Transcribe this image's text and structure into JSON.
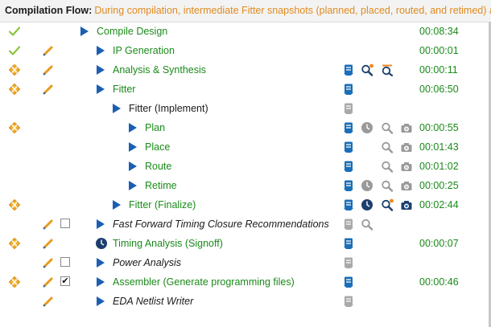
{
  "header": {
    "label": "Compilation Flow:",
    "description": "During compilation, intermediate Fitter snapshots (planned, placed, routed, and retimed) are created"
  },
  "colors": {
    "done_text": "#1a8a1a",
    "play_blue": "#1a5fb4",
    "warn_orange": "#e8a020",
    "header_desc": "#e08a1e"
  },
  "tasks": [
    {
      "label": "Compile Design",
      "time": "00:08:34",
      "status": "check",
      "pencil": false,
      "checkbox": null,
      "runner": "play",
      "indent": 0,
      "style": "done",
      "icons": []
    },
    {
      "label": "IP Generation",
      "time": "00:00:01",
      "status": "check",
      "pencil": true,
      "checkbox": null,
      "runner": "play",
      "indent": 1,
      "style": "done",
      "icons": []
    },
    {
      "label": "Analysis & Synthesis",
      "time": "00:00:11",
      "status": "warning",
      "pencil": true,
      "checkbox": null,
      "runner": "play",
      "indent": 1,
      "style": "done",
      "icons": [
        "report-icon",
        "search-report-icon",
        "rtl-viewer-icon"
      ]
    },
    {
      "label": "Fitter",
      "time": "00:06:50",
      "status": "warning",
      "pencil": true,
      "checkbox": null,
      "runner": "play",
      "indent": 1,
      "style": "done",
      "icons": [
        "report-icon"
      ]
    },
    {
      "label": "Fitter (Implement)",
      "time": "",
      "status": "none",
      "pencil": false,
      "checkbox": null,
      "runner": "play",
      "indent": 2,
      "style": "plain",
      "icons": [
        "report-icon-disabled"
      ]
    },
    {
      "label": "Plan",
      "time": "00:00:55",
      "status": "warning",
      "pencil": false,
      "checkbox": null,
      "runner": "play",
      "indent": 3,
      "style": "done",
      "icons": [
        "report-icon",
        "clock-icon-gray",
        "search-report-icon-gray",
        "chip-planner-icon-gray"
      ]
    },
    {
      "label": "Place",
      "time": "00:01:43",
      "status": "none",
      "pencil": false,
      "checkbox": null,
      "runner": "play",
      "indent": 3,
      "style": "done",
      "icons": [
        "report-icon",
        "",
        "search-report-icon-gray",
        "chip-planner-icon-gray"
      ]
    },
    {
      "label": "Route",
      "time": "00:01:02",
      "status": "none",
      "pencil": false,
      "checkbox": null,
      "runner": "play",
      "indent": 3,
      "style": "done",
      "icons": [
        "report-icon",
        "",
        "search-report-icon-gray",
        "chip-planner-icon-gray"
      ]
    },
    {
      "label": "Retime",
      "time": "00:00:25",
      "status": "none",
      "pencil": false,
      "checkbox": null,
      "runner": "play",
      "indent": 3,
      "style": "done",
      "icons": [
        "report-icon",
        "clock-icon-gray",
        "search-report-icon-gray",
        "chip-planner-icon-gray"
      ]
    },
    {
      "label": "Fitter (Finalize)",
      "time": "00:02:44",
      "status": "warning",
      "pencil": false,
      "checkbox": null,
      "runner": "play",
      "indent": 2,
      "style": "done",
      "icons": [
        "report-icon",
        "clock-icon",
        "search-report-icon",
        "chip-planner-icon"
      ]
    },
    {
      "label": "Fast Forward Timing Closure Recommendations",
      "time": "",
      "status": "none",
      "pencil": true,
      "checkbox": false,
      "runner": "play",
      "indent": 1,
      "style": "italic",
      "icons": [
        "report-icon-disabled",
        "search-report-icon-gray"
      ]
    },
    {
      "label": "Timing Analysis (Signoff)",
      "time": "00:00:07",
      "status": "warning",
      "pencil": true,
      "checkbox": null,
      "runner": "clock",
      "indent": 1,
      "style": "done",
      "icons": [
        "report-icon"
      ]
    },
    {
      "label": "Power Analysis",
      "time": "",
      "status": "none",
      "pencil": true,
      "checkbox": false,
      "runner": "play",
      "indent": 1,
      "style": "italic",
      "icons": [
        "report-icon-disabled"
      ]
    },
    {
      "label": "Assembler (Generate programming files)",
      "time": "00:00:46",
      "status": "warning",
      "pencil": true,
      "checkbox": true,
      "runner": "play",
      "indent": 1,
      "style": "done",
      "icons": [
        "report-icon"
      ]
    },
    {
      "label": "EDA Netlist Writer",
      "time": "",
      "status": "none",
      "pencil": true,
      "checkbox": null,
      "runner": "play",
      "indent": 1,
      "style": "italic",
      "icons": [
        "report-icon-disabled"
      ]
    }
  ]
}
